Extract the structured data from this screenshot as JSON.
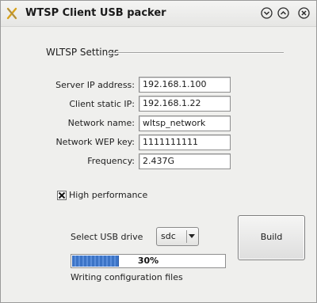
{
  "window": {
    "title": "WTSP Client USB packer"
  },
  "settings": {
    "group_title": "WLTSP Settings",
    "fields": [
      {
        "label": "Server IP address:",
        "value": "192.168.1.100"
      },
      {
        "label": "Client static IP:",
        "value": "192.168.1.22"
      },
      {
        "label": "Network name:",
        "value": "wltsp_network"
      },
      {
        "label": "Network WEP key:",
        "value": "1111111111"
      },
      {
        "label": "Frequency:",
        "value": "2.437G"
      }
    ]
  },
  "options": {
    "high_performance_label": "High performance",
    "high_performance_checked": true
  },
  "usb": {
    "label": "Select USB drive",
    "selected": "sdc"
  },
  "actions": {
    "build_label": "Build"
  },
  "progress": {
    "value": 30,
    "text": "30%",
    "status": "Writing configuration files",
    "color": "#3c74c6"
  },
  "icons": {
    "app": "app-x-icon",
    "minimize": "chevron-down-circle-icon",
    "maximize": "chevron-up-circle-icon",
    "close": "close-circle-icon"
  }
}
